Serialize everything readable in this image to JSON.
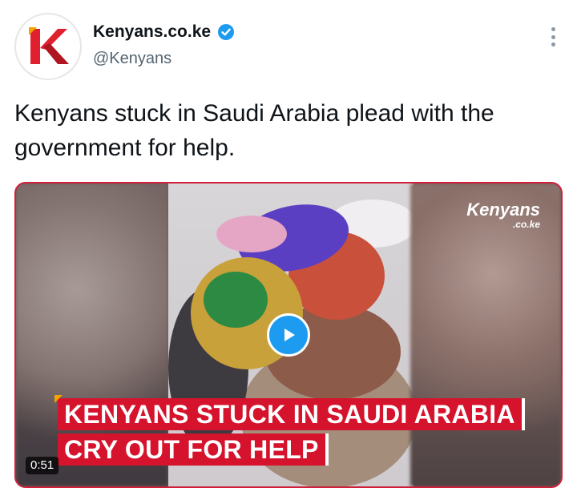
{
  "account": {
    "name": "Kenyans.co.ke",
    "handle": "@Kenyans",
    "verified": true,
    "avatar_letter": "K",
    "avatar_icon": "kenyans-logo-icon",
    "verified_icon": "verified-badge-icon"
  },
  "menu": {
    "icon": "more-options-icon"
  },
  "tweet": {
    "text": "Kenyans stuck in Saudi Arabia plead with the government for help."
  },
  "video": {
    "watermark_top": "Kenyans",
    "watermark_bottom": ".co.ke",
    "caption_line_1": "KENYANS STUCK IN SAUDI ARABIA",
    "caption_line_2": "CRY OUT FOR HELP",
    "duration": "0:51",
    "play_icon": "play-icon"
  },
  "colors": {
    "accent": "#1d9bf0",
    "caption_red": "#d5132d",
    "handle_gray": "#536471",
    "media_border": "#cf1f3a"
  }
}
